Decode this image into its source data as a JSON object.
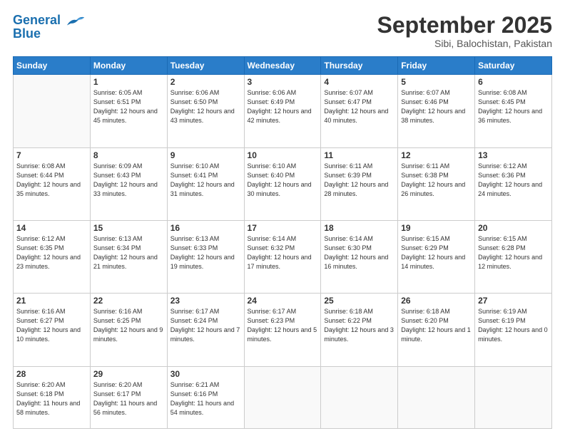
{
  "logo": {
    "line1": "General",
    "line2": "Blue"
  },
  "title": "September 2025",
  "subtitle": "Sibi, Balochistan, Pakistan",
  "weekdays": [
    "Sunday",
    "Monday",
    "Tuesday",
    "Wednesday",
    "Thursday",
    "Friday",
    "Saturday"
  ],
  "weeks": [
    [
      {
        "day": "",
        "sunrise": "",
        "sunset": "",
        "daylight": ""
      },
      {
        "day": "1",
        "sunrise": "Sunrise: 6:05 AM",
        "sunset": "Sunset: 6:51 PM",
        "daylight": "Daylight: 12 hours and 45 minutes."
      },
      {
        "day": "2",
        "sunrise": "Sunrise: 6:06 AM",
        "sunset": "Sunset: 6:50 PM",
        "daylight": "Daylight: 12 hours and 43 minutes."
      },
      {
        "day": "3",
        "sunrise": "Sunrise: 6:06 AM",
        "sunset": "Sunset: 6:49 PM",
        "daylight": "Daylight: 12 hours and 42 minutes."
      },
      {
        "day": "4",
        "sunrise": "Sunrise: 6:07 AM",
        "sunset": "Sunset: 6:47 PM",
        "daylight": "Daylight: 12 hours and 40 minutes."
      },
      {
        "day": "5",
        "sunrise": "Sunrise: 6:07 AM",
        "sunset": "Sunset: 6:46 PM",
        "daylight": "Daylight: 12 hours and 38 minutes."
      },
      {
        "day": "6",
        "sunrise": "Sunrise: 6:08 AM",
        "sunset": "Sunset: 6:45 PM",
        "daylight": "Daylight: 12 hours and 36 minutes."
      }
    ],
    [
      {
        "day": "7",
        "sunrise": "Sunrise: 6:08 AM",
        "sunset": "Sunset: 6:44 PM",
        "daylight": "Daylight: 12 hours and 35 minutes."
      },
      {
        "day": "8",
        "sunrise": "Sunrise: 6:09 AM",
        "sunset": "Sunset: 6:43 PM",
        "daylight": "Daylight: 12 hours and 33 minutes."
      },
      {
        "day": "9",
        "sunrise": "Sunrise: 6:10 AM",
        "sunset": "Sunset: 6:41 PM",
        "daylight": "Daylight: 12 hours and 31 minutes."
      },
      {
        "day": "10",
        "sunrise": "Sunrise: 6:10 AM",
        "sunset": "Sunset: 6:40 PM",
        "daylight": "Daylight: 12 hours and 30 minutes."
      },
      {
        "day": "11",
        "sunrise": "Sunrise: 6:11 AM",
        "sunset": "Sunset: 6:39 PM",
        "daylight": "Daylight: 12 hours and 28 minutes."
      },
      {
        "day": "12",
        "sunrise": "Sunrise: 6:11 AM",
        "sunset": "Sunset: 6:38 PM",
        "daylight": "Daylight: 12 hours and 26 minutes."
      },
      {
        "day": "13",
        "sunrise": "Sunrise: 6:12 AM",
        "sunset": "Sunset: 6:36 PM",
        "daylight": "Daylight: 12 hours and 24 minutes."
      }
    ],
    [
      {
        "day": "14",
        "sunrise": "Sunrise: 6:12 AM",
        "sunset": "Sunset: 6:35 PM",
        "daylight": "Daylight: 12 hours and 23 minutes."
      },
      {
        "day": "15",
        "sunrise": "Sunrise: 6:13 AM",
        "sunset": "Sunset: 6:34 PM",
        "daylight": "Daylight: 12 hours and 21 minutes."
      },
      {
        "day": "16",
        "sunrise": "Sunrise: 6:13 AM",
        "sunset": "Sunset: 6:33 PM",
        "daylight": "Daylight: 12 hours and 19 minutes."
      },
      {
        "day": "17",
        "sunrise": "Sunrise: 6:14 AM",
        "sunset": "Sunset: 6:32 PM",
        "daylight": "Daylight: 12 hours and 17 minutes."
      },
      {
        "day": "18",
        "sunrise": "Sunrise: 6:14 AM",
        "sunset": "Sunset: 6:30 PM",
        "daylight": "Daylight: 12 hours and 16 minutes."
      },
      {
        "day": "19",
        "sunrise": "Sunrise: 6:15 AM",
        "sunset": "Sunset: 6:29 PM",
        "daylight": "Daylight: 12 hours and 14 minutes."
      },
      {
        "day": "20",
        "sunrise": "Sunrise: 6:15 AM",
        "sunset": "Sunset: 6:28 PM",
        "daylight": "Daylight: 12 hours and 12 minutes."
      }
    ],
    [
      {
        "day": "21",
        "sunrise": "Sunrise: 6:16 AM",
        "sunset": "Sunset: 6:27 PM",
        "daylight": "Daylight: 12 hours and 10 minutes."
      },
      {
        "day": "22",
        "sunrise": "Sunrise: 6:16 AM",
        "sunset": "Sunset: 6:25 PM",
        "daylight": "Daylight: 12 hours and 9 minutes."
      },
      {
        "day": "23",
        "sunrise": "Sunrise: 6:17 AM",
        "sunset": "Sunset: 6:24 PM",
        "daylight": "Daylight: 12 hours and 7 minutes."
      },
      {
        "day": "24",
        "sunrise": "Sunrise: 6:17 AM",
        "sunset": "Sunset: 6:23 PM",
        "daylight": "Daylight: 12 hours and 5 minutes."
      },
      {
        "day": "25",
        "sunrise": "Sunrise: 6:18 AM",
        "sunset": "Sunset: 6:22 PM",
        "daylight": "Daylight: 12 hours and 3 minutes."
      },
      {
        "day": "26",
        "sunrise": "Sunrise: 6:18 AM",
        "sunset": "Sunset: 6:20 PM",
        "daylight": "Daylight: 12 hours and 1 minute."
      },
      {
        "day": "27",
        "sunrise": "Sunrise: 6:19 AM",
        "sunset": "Sunset: 6:19 PM",
        "daylight": "Daylight: 12 hours and 0 minutes."
      }
    ],
    [
      {
        "day": "28",
        "sunrise": "Sunrise: 6:20 AM",
        "sunset": "Sunset: 6:18 PM",
        "daylight": "Daylight: 11 hours and 58 minutes."
      },
      {
        "day": "29",
        "sunrise": "Sunrise: 6:20 AM",
        "sunset": "Sunset: 6:17 PM",
        "daylight": "Daylight: 11 hours and 56 minutes."
      },
      {
        "day": "30",
        "sunrise": "Sunrise: 6:21 AM",
        "sunset": "Sunset: 6:16 PM",
        "daylight": "Daylight: 11 hours and 54 minutes."
      },
      {
        "day": "",
        "sunrise": "",
        "sunset": "",
        "daylight": ""
      },
      {
        "day": "",
        "sunrise": "",
        "sunset": "",
        "daylight": ""
      },
      {
        "day": "",
        "sunrise": "",
        "sunset": "",
        "daylight": ""
      },
      {
        "day": "",
        "sunrise": "",
        "sunset": "",
        "daylight": ""
      }
    ]
  ]
}
